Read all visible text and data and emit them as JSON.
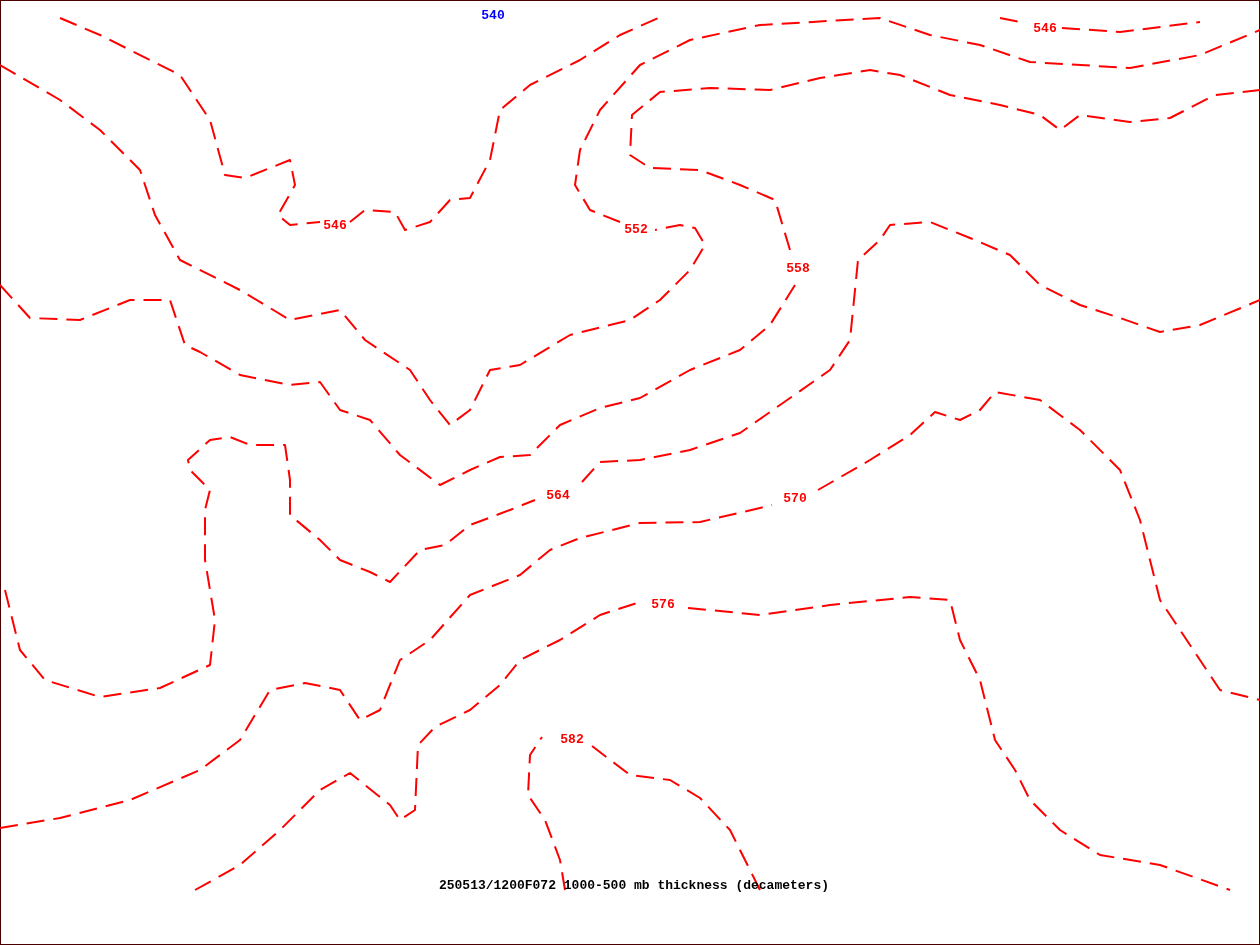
{
  "map": {
    "contour_labels": [
      {
        "text": "540",
        "color": "#0000ff"
      },
      {
        "text": "546",
        "color": "#ff0000"
      },
      {
        "text": "546",
        "color": "#ff0000"
      },
      {
        "text": "552",
        "color": "#ff0000"
      },
      {
        "text": "558",
        "color": "#ff0000"
      },
      {
        "text": "564",
        "color": "#ff0000"
      },
      {
        "text": "570",
        "color": "#ff0000"
      },
      {
        "text": "576",
        "color": "#ff0000"
      },
      {
        "text": "582",
        "color": "#ff0000"
      }
    ],
    "caption": "250513/1200F072 1000-500 mb thickness (decameters)"
  }
}
